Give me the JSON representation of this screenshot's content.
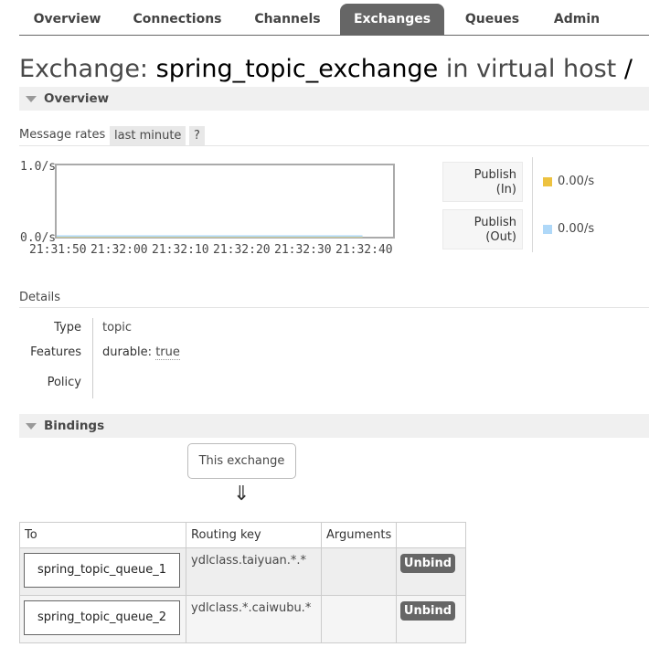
{
  "nav": {
    "tabs": [
      {
        "label": "Overview"
      },
      {
        "label": "Connections"
      },
      {
        "label": "Channels"
      },
      {
        "label": "Exchanges",
        "selected": true
      },
      {
        "label": "Queues"
      },
      {
        "label": "Admin"
      }
    ]
  },
  "title": {
    "prefix": "Exchange:",
    "name": "spring_topic_exchange",
    "middle": "in virtual host",
    "vhost": "/"
  },
  "overview": {
    "header": "Overview",
    "message_rates_label": "Message rates",
    "range_option": "last minute",
    "help": "?"
  },
  "chart_data": {
    "type": "line",
    "y_tick_labels": [
      "1.0/s",
      "0.0/s"
    ],
    "ylim": [
      0,
      1
    ],
    "x": [
      "21:31:50",
      "21:32:00",
      "21:32:10",
      "21:32:20",
      "21:32:30",
      "21:32:40"
    ],
    "series": [
      {
        "name": "Publish (In)",
        "color": "#edc240",
        "values": [
          0,
          0,
          0,
          0,
          0,
          0
        ]
      },
      {
        "name": "Publish (Out)",
        "color": "#afd8f8",
        "values": [
          0,
          0,
          0,
          0,
          0,
          0
        ]
      }
    ],
    "title": "",
    "xlabel": "",
    "ylabel": ""
  },
  "legend": [
    {
      "line1": "Publish",
      "line2": "(In)",
      "value": "0.00/s",
      "color": "#edc240"
    },
    {
      "line1": "Publish",
      "line2": "(Out)",
      "value": "0.00/s",
      "color": "#afd8f8"
    }
  ],
  "details": {
    "label": "Details",
    "type_key": "Type",
    "type_value": "topic",
    "features_key": "Features",
    "features_name": "durable:",
    "features_value": "true",
    "policy_key": "Policy"
  },
  "bindings": {
    "header": "Bindings",
    "this_exchange": "This exchange",
    "arrow": "⇓",
    "columns": [
      "To",
      "Routing key",
      "Arguments",
      ""
    ],
    "rows": [
      {
        "queue": "spring_topic_queue_1",
        "routing_key": "ydlclass.taiyuan.*.*",
        "unbind": "Unbind"
      },
      {
        "queue": "spring_topic_queue_2",
        "routing_key": "ydlclass.*.caiwubu.*",
        "unbind": "Unbind"
      }
    ]
  }
}
